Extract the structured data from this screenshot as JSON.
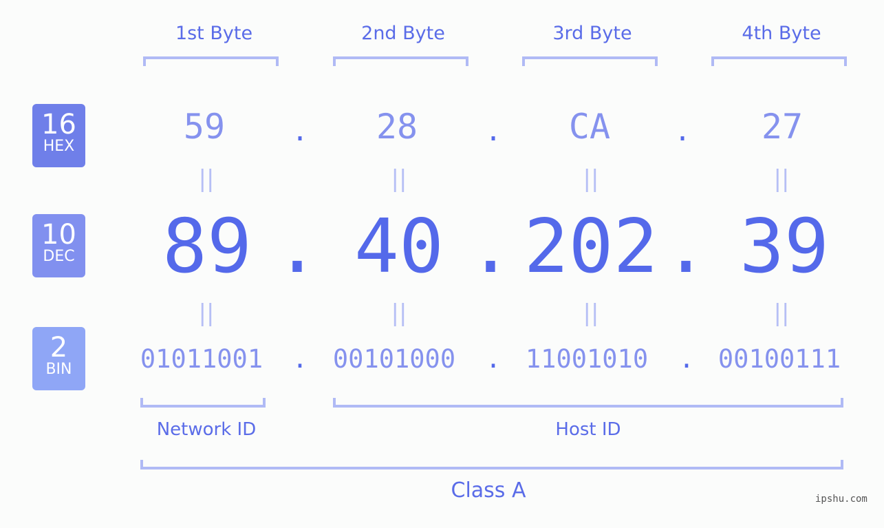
{
  "bytes": [
    {
      "label": "1st Byte",
      "hex": "59",
      "dec": "89",
      "bin": "01011001"
    },
    {
      "label": "2nd Byte",
      "hex": "28",
      "dec": "40",
      "bin": "00101000"
    },
    {
      "label": "3rd Byte",
      "hex": "CA",
      "dec": "202",
      "bin": "11001010"
    },
    {
      "label": "4th Byte",
      "hex": "27",
      "dec": "39",
      "bin": "00100111"
    }
  ],
  "separator": ".",
  "equals": "||",
  "badges": {
    "hex": {
      "num": "16",
      "label": "HEX",
      "color": "#6f7fe9"
    },
    "dec": {
      "num": "10",
      "label": "DEC",
      "color": "#8190ef"
    },
    "bin": {
      "num": "2",
      "label": "BIN",
      "color": "#8fa6f6"
    }
  },
  "segments": {
    "network": "Network ID",
    "host": "Host ID",
    "class": "Class A"
  },
  "watermark": "ipshu.com"
}
